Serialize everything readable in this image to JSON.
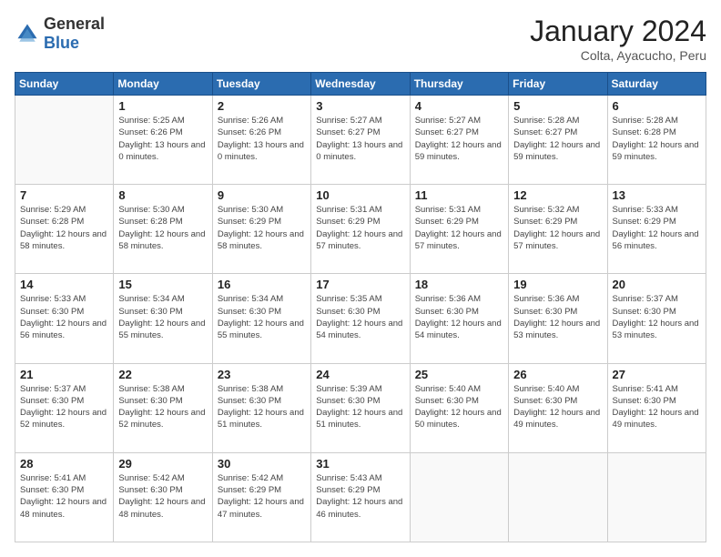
{
  "header": {
    "logo": {
      "general": "General",
      "blue": "Blue"
    },
    "title": "January 2024",
    "subtitle": "Colta, Ayacucho, Peru"
  },
  "calendar": {
    "weekdays": [
      "Sunday",
      "Monday",
      "Tuesday",
      "Wednesday",
      "Thursday",
      "Friday",
      "Saturday"
    ],
    "weeks": [
      [
        {
          "day": "",
          "info": ""
        },
        {
          "day": "1",
          "info": "Sunrise: 5:25 AM\nSunset: 6:26 PM\nDaylight: 13 hours\nand 0 minutes."
        },
        {
          "day": "2",
          "info": "Sunrise: 5:26 AM\nSunset: 6:26 PM\nDaylight: 13 hours\nand 0 minutes."
        },
        {
          "day": "3",
          "info": "Sunrise: 5:27 AM\nSunset: 6:27 PM\nDaylight: 13 hours\nand 0 minutes."
        },
        {
          "day": "4",
          "info": "Sunrise: 5:27 AM\nSunset: 6:27 PM\nDaylight: 12 hours\nand 59 minutes."
        },
        {
          "day": "5",
          "info": "Sunrise: 5:28 AM\nSunset: 6:27 PM\nDaylight: 12 hours\nand 59 minutes."
        },
        {
          "day": "6",
          "info": "Sunrise: 5:28 AM\nSunset: 6:28 PM\nDaylight: 12 hours\nand 59 minutes."
        }
      ],
      [
        {
          "day": "7",
          "info": "Sunrise: 5:29 AM\nSunset: 6:28 PM\nDaylight: 12 hours\nand 58 minutes."
        },
        {
          "day": "8",
          "info": "Sunrise: 5:30 AM\nSunset: 6:28 PM\nDaylight: 12 hours\nand 58 minutes."
        },
        {
          "day": "9",
          "info": "Sunrise: 5:30 AM\nSunset: 6:29 PM\nDaylight: 12 hours\nand 58 minutes."
        },
        {
          "day": "10",
          "info": "Sunrise: 5:31 AM\nSunset: 6:29 PM\nDaylight: 12 hours\nand 57 minutes."
        },
        {
          "day": "11",
          "info": "Sunrise: 5:31 AM\nSunset: 6:29 PM\nDaylight: 12 hours\nand 57 minutes."
        },
        {
          "day": "12",
          "info": "Sunrise: 5:32 AM\nSunset: 6:29 PM\nDaylight: 12 hours\nand 57 minutes."
        },
        {
          "day": "13",
          "info": "Sunrise: 5:33 AM\nSunset: 6:29 PM\nDaylight: 12 hours\nand 56 minutes."
        }
      ],
      [
        {
          "day": "14",
          "info": "Sunrise: 5:33 AM\nSunset: 6:30 PM\nDaylight: 12 hours\nand 56 minutes."
        },
        {
          "day": "15",
          "info": "Sunrise: 5:34 AM\nSunset: 6:30 PM\nDaylight: 12 hours\nand 55 minutes."
        },
        {
          "day": "16",
          "info": "Sunrise: 5:34 AM\nSunset: 6:30 PM\nDaylight: 12 hours\nand 55 minutes."
        },
        {
          "day": "17",
          "info": "Sunrise: 5:35 AM\nSunset: 6:30 PM\nDaylight: 12 hours\nand 54 minutes."
        },
        {
          "day": "18",
          "info": "Sunrise: 5:36 AM\nSunset: 6:30 PM\nDaylight: 12 hours\nand 54 minutes."
        },
        {
          "day": "19",
          "info": "Sunrise: 5:36 AM\nSunset: 6:30 PM\nDaylight: 12 hours\nand 53 minutes."
        },
        {
          "day": "20",
          "info": "Sunrise: 5:37 AM\nSunset: 6:30 PM\nDaylight: 12 hours\nand 53 minutes."
        }
      ],
      [
        {
          "day": "21",
          "info": "Sunrise: 5:37 AM\nSunset: 6:30 PM\nDaylight: 12 hours\nand 52 minutes."
        },
        {
          "day": "22",
          "info": "Sunrise: 5:38 AM\nSunset: 6:30 PM\nDaylight: 12 hours\nand 52 minutes."
        },
        {
          "day": "23",
          "info": "Sunrise: 5:38 AM\nSunset: 6:30 PM\nDaylight: 12 hours\nand 51 minutes."
        },
        {
          "day": "24",
          "info": "Sunrise: 5:39 AM\nSunset: 6:30 PM\nDaylight: 12 hours\nand 51 minutes."
        },
        {
          "day": "25",
          "info": "Sunrise: 5:40 AM\nSunset: 6:30 PM\nDaylight: 12 hours\nand 50 minutes."
        },
        {
          "day": "26",
          "info": "Sunrise: 5:40 AM\nSunset: 6:30 PM\nDaylight: 12 hours\nand 49 minutes."
        },
        {
          "day": "27",
          "info": "Sunrise: 5:41 AM\nSunset: 6:30 PM\nDaylight: 12 hours\nand 49 minutes."
        }
      ],
      [
        {
          "day": "28",
          "info": "Sunrise: 5:41 AM\nSunset: 6:30 PM\nDaylight: 12 hours\nand 48 minutes."
        },
        {
          "day": "29",
          "info": "Sunrise: 5:42 AM\nSunset: 6:30 PM\nDaylight: 12 hours\nand 48 minutes."
        },
        {
          "day": "30",
          "info": "Sunrise: 5:42 AM\nSunset: 6:29 PM\nDaylight: 12 hours\nand 47 minutes."
        },
        {
          "day": "31",
          "info": "Sunrise: 5:43 AM\nSunset: 6:29 PM\nDaylight: 12 hours\nand 46 minutes."
        },
        {
          "day": "",
          "info": ""
        },
        {
          "day": "",
          "info": ""
        },
        {
          "day": "",
          "info": ""
        }
      ]
    ]
  }
}
